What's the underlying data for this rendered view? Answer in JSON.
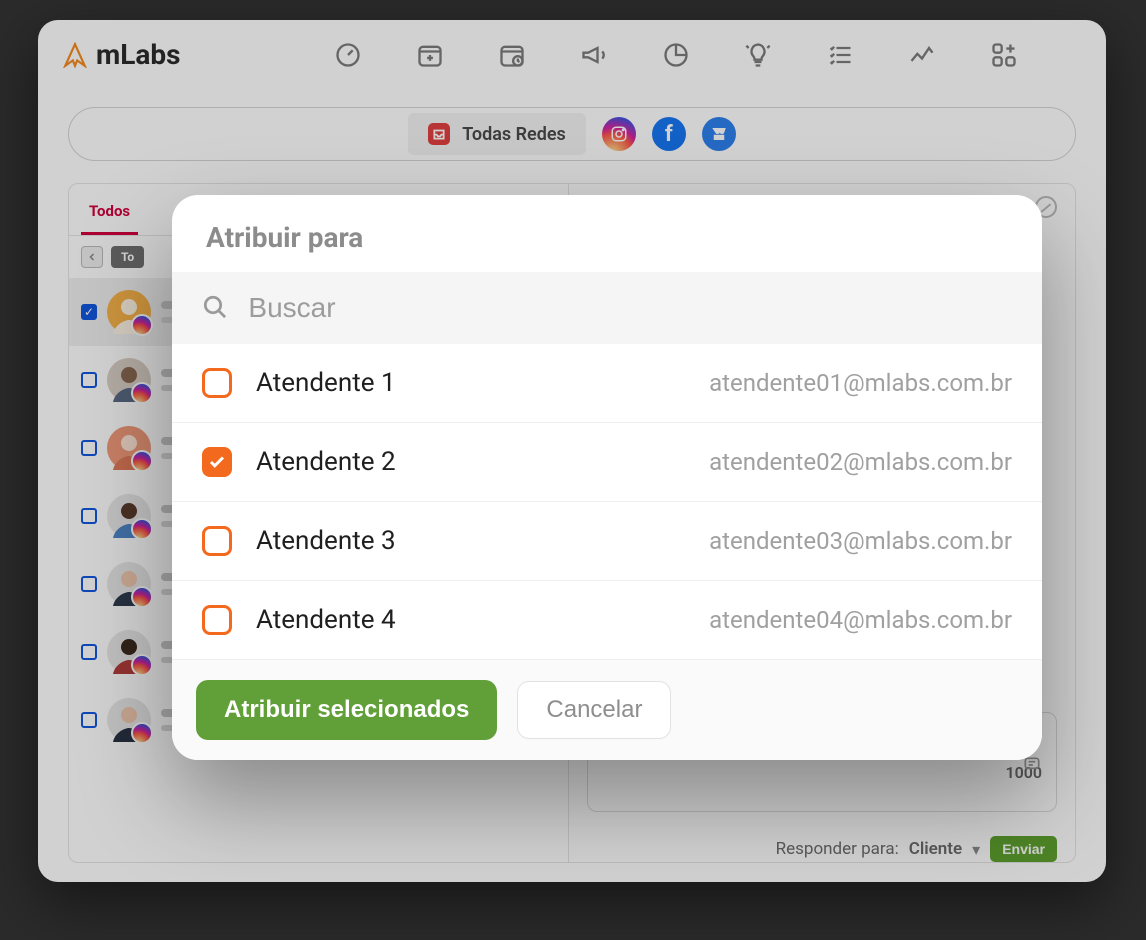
{
  "logo_text": "mLabs",
  "net_all_label": "Todas Redes",
  "tabs": {
    "all": "Todos"
  },
  "reply": {
    "chars": "1000",
    "label": "Responder para:",
    "target": "Cliente",
    "send": "Enviar"
  },
  "modal": {
    "title": "Atribuir para",
    "search_placeholder": "Buscar",
    "items": [
      {
        "name": "Atendente 1",
        "email": "atendente01@mlabs.com.br",
        "checked": false
      },
      {
        "name": "Atendente 2",
        "email": "atendente02@mlabs.com.br",
        "checked": true
      },
      {
        "name": "Atendente 3",
        "email": "atendente03@mlabs.com.br",
        "checked": false
      },
      {
        "name": "Atendente 4",
        "email": "atendente04@mlabs.com.br",
        "checked": false
      }
    ],
    "assign_btn": "Atribuir selecionados",
    "cancel_btn": "Cancelar"
  }
}
